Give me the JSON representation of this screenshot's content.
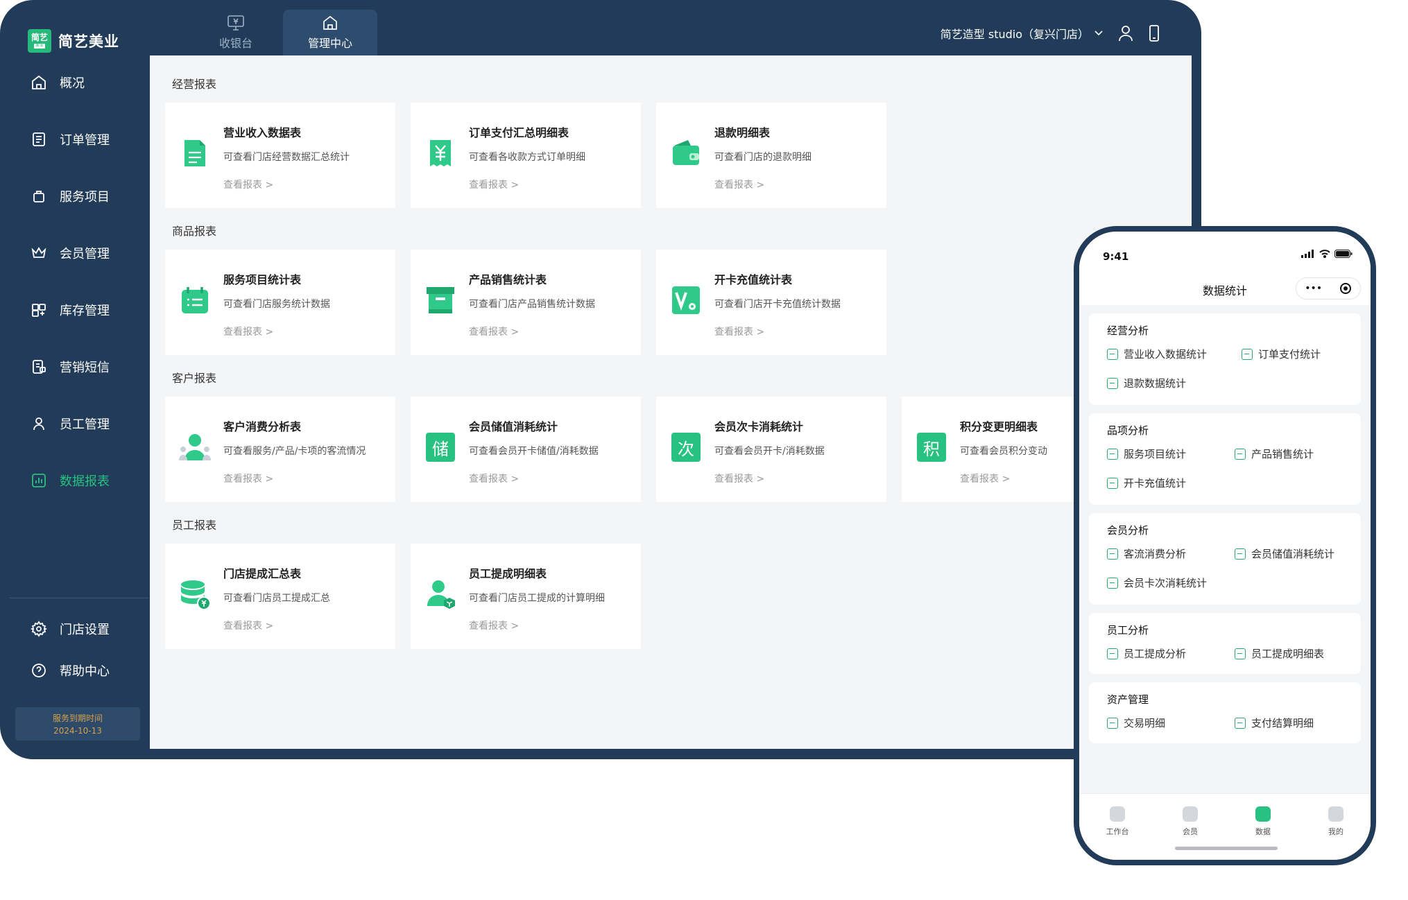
{
  "brand": {
    "mark": "简艺",
    "mark_sub": "美业",
    "name": "简艺美业"
  },
  "top_tabs": [
    {
      "label": "收银台",
      "icon": "cashier-monitor-icon"
    },
    {
      "label": "管理中心",
      "icon": "home-icon"
    }
  ],
  "top_right": {
    "store": "简艺造型 studio（复兴门店）"
  },
  "sidebar": {
    "items": [
      {
        "label": "概况",
        "icon": "home-icon"
      },
      {
        "label": "订单管理",
        "icon": "order-icon"
      },
      {
        "label": "服务项目",
        "icon": "bag-icon"
      },
      {
        "label": "会员管理",
        "icon": "crown-icon"
      },
      {
        "label": "库存管理",
        "icon": "inventory-icon"
      },
      {
        "label": "营销短信",
        "icon": "sms-icon"
      },
      {
        "label": "员工管理",
        "icon": "staff-icon"
      },
      {
        "label": "数据报表",
        "icon": "report-icon"
      }
    ],
    "bottom_items": [
      {
        "label": "门店设置",
        "icon": "gear-icon"
      },
      {
        "label": "帮助中心",
        "icon": "help-icon"
      }
    ],
    "expire_label": "服务到期时间",
    "expire_date": "2024-10-13"
  },
  "sections": [
    {
      "title": "经营报表",
      "cards": [
        {
          "title": "营业收入数据表",
          "desc": "可查看门店经营数据汇总统计",
          "link": "查看报表 >"
        },
        {
          "title": "订单支付汇总明细表",
          "desc": "可查看各收款方式订单明细",
          "link": "查看报表 >"
        },
        {
          "title": "退款明细表",
          "desc": "可查看门店的退款明细",
          "link": "查看报表 >"
        }
      ]
    },
    {
      "title": "商品报表",
      "cards": [
        {
          "title": "服务项目统计表",
          "desc": "可查看门店服务统计数据",
          "link": "查看报表 >"
        },
        {
          "title": "产品销售统计表",
          "desc": "可查看门店产品销售统计数据",
          "link": "查看报表 >"
        },
        {
          "title": "开卡充值统计表",
          "desc": "可查看门店开卡充值统计数据",
          "link": "查看报表 >"
        }
      ]
    },
    {
      "title": "客户报表",
      "cards": [
        {
          "title": "客户消费分析表",
          "desc": "可查看服务/产品/卡项的客流情况",
          "link": "查看报表 >"
        },
        {
          "title": "会员储值消耗统计",
          "desc": "可查看会员开卡储值/消耗数据",
          "link": "查看报表 >",
          "glyph": "储"
        },
        {
          "title": "会员次卡消耗统计",
          "desc": "可查看会员开卡/消耗数据",
          "link": "查看报表 >",
          "glyph": "次"
        },
        {
          "title": "积分变更明细表",
          "desc": "可查看会员积分变动",
          "link": "查看报表 >",
          "glyph": "积"
        }
      ]
    },
    {
      "title": "员工报表",
      "cards": [
        {
          "title": "门店提成汇总表",
          "desc": "可查看门店员工提成汇总",
          "link": "查看报表 >"
        },
        {
          "title": "员工提成明细表",
          "desc": "可查看门店员工提成的计算明细",
          "link": "查看报表 >"
        }
      ]
    }
  ],
  "phone": {
    "time": "9:41",
    "title": "数据统计",
    "capsule_more": "•••",
    "groups": [
      {
        "title": "经营分析",
        "items": [
          "营业收入数据统计",
          "订单支付统计",
          "退款数据统计"
        ]
      },
      {
        "title": "品项分析",
        "items": [
          "服务项目统计",
          "产品销售统计",
          "开卡充值统计"
        ]
      },
      {
        "title": "会员分析",
        "items": [
          "客流消费分析",
          "会员储值消耗统计",
          "会员卡次消耗统计"
        ]
      },
      {
        "title": "员工分析",
        "items": [
          "员工提成分析",
          "员工提成明细表"
        ]
      },
      {
        "title": "资产管理",
        "items": [
          "交易明细",
          "支付结算明细"
        ]
      }
    ],
    "tabs": [
      {
        "label": "工作台"
      },
      {
        "label": "会员"
      },
      {
        "label": "数据"
      },
      {
        "label": "我的"
      }
    ]
  },
  "colors": {
    "navy": "#213b58",
    "accent": "#27c281",
    "content_bg": "#f4f5f7",
    "expire_text": "#d6a14a"
  }
}
